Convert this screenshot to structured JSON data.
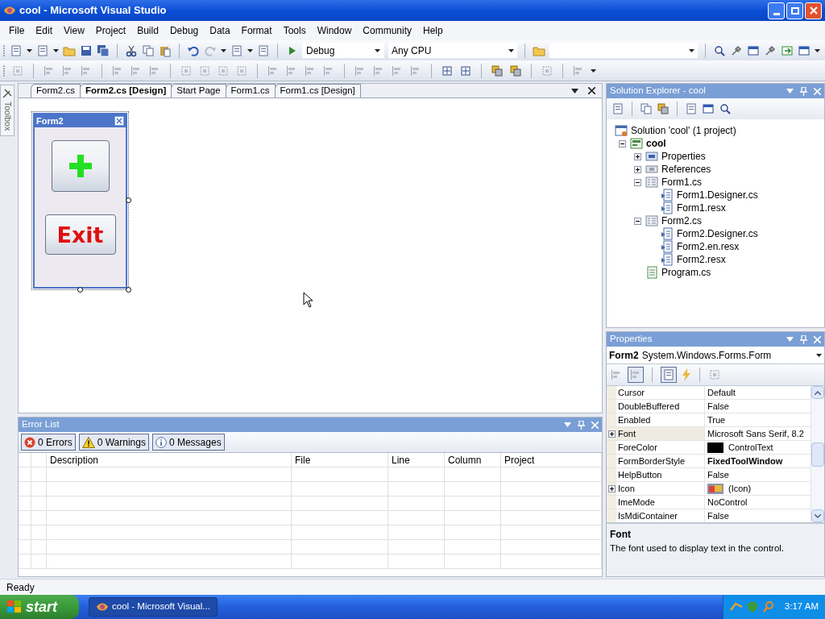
{
  "window": {
    "title": "cool - Microsoft Visual Studio"
  },
  "menu": [
    "File",
    "Edit",
    "View",
    "Project",
    "Build",
    "Debug",
    "Data",
    "Format",
    "Tools",
    "Window",
    "Community",
    "Help"
  ],
  "toolbar": {
    "configuration": "Debug",
    "platform": "Any CPU"
  },
  "toolbox_tab": {
    "label": "Toolbox"
  },
  "document_tabs": [
    {
      "label": "Form2.cs",
      "selected": false
    },
    {
      "label": "Form2.cs [Design]",
      "selected": true
    },
    {
      "label": "Start Page",
      "selected": false
    },
    {
      "label": "Form1.cs",
      "selected": false
    },
    {
      "label": "Form1.cs [Design]",
      "selected": false
    }
  ],
  "designer_form": {
    "title": "Form2",
    "buttons": [
      {
        "kind": "plus-icon"
      },
      {
        "kind": "text",
        "label": "Exit"
      }
    ]
  },
  "error_list": {
    "title": "Error List",
    "filters": [
      {
        "kind": "error",
        "label": "0 Errors",
        "selected": true
      },
      {
        "kind": "warning",
        "label": "0 Warnings",
        "selected": true
      },
      {
        "kind": "message",
        "label": "0 Messages",
        "selected": true
      }
    ],
    "columns": [
      "Description",
      "File",
      "Line",
      "Column",
      "Project"
    ]
  },
  "solution_explorer": {
    "title": "Solution Explorer - cool",
    "tree": [
      {
        "label": "Solution 'cool' (1 project)",
        "kind": "solution",
        "children": [
          {
            "label": "cool",
            "kind": "project",
            "bold": true,
            "expanded": true,
            "children": [
              {
                "label": "Properties",
                "kind": "properties",
                "expanded": false
              },
              {
                "label": "References",
                "kind": "references",
                "expanded": false
              },
              {
                "label": "Form1.cs",
                "kind": "form",
                "expanded": true,
                "children": [
                  {
                    "label": "Form1.Designer.cs",
                    "kind": "file"
                  },
                  {
                    "label": "Form1.resx",
                    "kind": "file"
                  }
                ]
              },
              {
                "label": "Form2.cs",
                "kind": "form",
                "expanded": true,
                "children": [
                  {
                    "label": "Form2.Designer.cs",
                    "kind": "file"
                  },
                  {
                    "label": "Form2.en.resx",
                    "kind": "file"
                  },
                  {
                    "label": "Form2.resx",
                    "kind": "file"
                  }
                ]
              },
              {
                "label": "Program.cs",
                "kind": "csharp"
              }
            ]
          }
        ]
      }
    ]
  },
  "properties": {
    "title": "Properties",
    "object_name": "Form2",
    "object_type": "System.Windows.Forms.Form",
    "rows": [
      {
        "name": "Cursor",
        "value": "Default",
        "kind": "text",
        "selected": false
      },
      {
        "name": "DoubleBuffered",
        "value": "False",
        "kind": "text",
        "selected": false
      },
      {
        "name": "Enabled",
        "value": "True",
        "kind": "text",
        "selected": false
      },
      {
        "name": "Font",
        "value": "Microsoft Sans Serif, 8.2",
        "kind": "text",
        "expandable": true,
        "selected": true
      },
      {
        "name": "ForeColor",
        "value": "ControlText",
        "kind": "color",
        "color": "#000000",
        "selected": false
      },
      {
        "name": "FormBorderStyle",
        "value": "FixedToolWindow",
        "kind": "text",
        "bold": true,
        "selected": false
      },
      {
        "name": "HelpButton",
        "value": "False",
        "kind": "text",
        "selected": false
      },
      {
        "name": "Icon",
        "value": "(Icon)",
        "kind": "icon",
        "expandable": true,
        "selected": false
      },
      {
        "name": "ImeMode",
        "value": "NoControl",
        "kind": "text",
        "selected": false
      },
      {
        "name": "IsMdiContainer",
        "value": "False",
        "kind": "text",
        "selected": false
      }
    ],
    "description_title": "Font",
    "description_text": "The font used to display text in the control."
  },
  "status_bar": {
    "text": "Ready"
  },
  "taskbar": {
    "start": "start",
    "tasks": [
      {
        "label": "cool - Microsoft Visual...",
        "selected": true
      }
    ],
    "clock": "3:17 AM"
  }
}
